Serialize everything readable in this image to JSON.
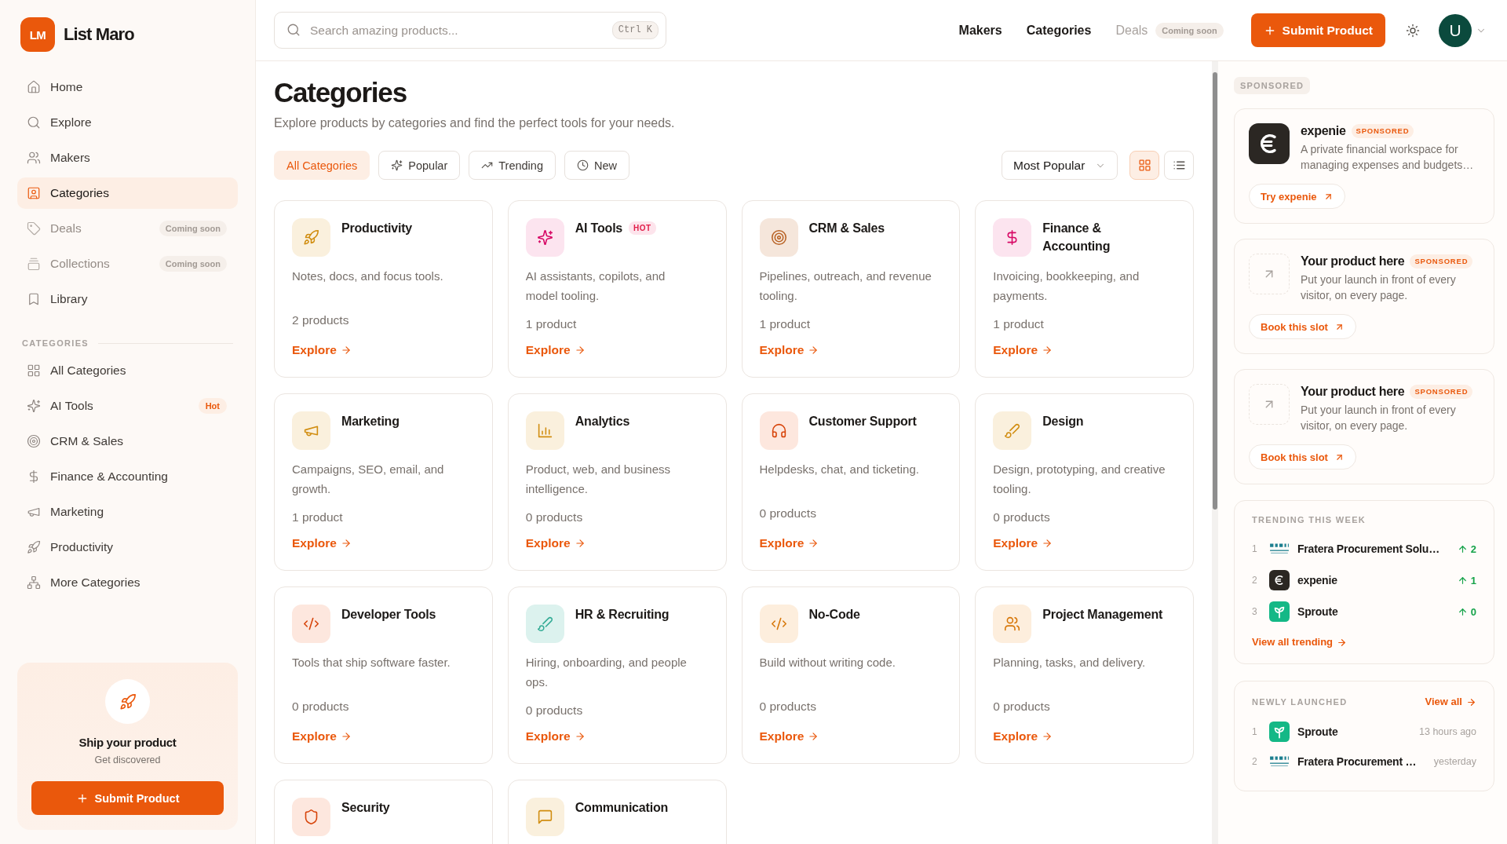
{
  "sidebar": {
    "logo": {
      "mark": "LM",
      "name": "List Maro"
    },
    "nav": [
      {
        "label": "Home",
        "selected": false,
        "disabled": false
      },
      {
        "label": "Explore",
        "selected": false,
        "disabled": false
      },
      {
        "label": "Makers",
        "selected": false,
        "disabled": false
      },
      {
        "label": "Categories",
        "selected": true,
        "disabled": false
      },
      {
        "label": "Deals",
        "selected": false,
        "disabled": true,
        "badge": "Coming soon"
      },
      {
        "label": "Collections",
        "selected": false,
        "disabled": true,
        "badge": "Coming soon"
      },
      {
        "label": "Library",
        "selected": false,
        "disabled": false
      }
    ],
    "section_title": "CATEGORIES",
    "category_links": [
      {
        "label": "All Categories",
        "selected": false
      },
      {
        "label": "AI Tools",
        "selected": false,
        "badge": "Hot"
      },
      {
        "label": "CRM & Sales",
        "selected": false
      },
      {
        "label": "Finance & Accounting",
        "selected": false
      },
      {
        "label": "Marketing",
        "selected": false
      },
      {
        "label": "Productivity",
        "selected": false
      },
      {
        "label": "More Categories",
        "selected": false
      }
    ],
    "promo": {
      "title": "Ship your product",
      "subtitle": "Get discovered",
      "button": "Submit Product"
    }
  },
  "header": {
    "search": {
      "placeholder": "Search amazing products...",
      "shortcut": "Ctrl K"
    },
    "nav": [
      {
        "label": "Makers",
        "disabled": false
      },
      {
        "label": "Categories",
        "disabled": false
      },
      {
        "label": "Deals",
        "disabled": true,
        "badge": "Coming soon"
      }
    ],
    "submit_button": "Submit Product",
    "avatar": "U"
  },
  "page": {
    "title": "Categories",
    "subtitle": "Explore products by categories and find the perfect tools for your needs.",
    "filters": [
      {
        "label": "All Categories",
        "selected": true
      },
      {
        "label": "Popular",
        "selected": false
      },
      {
        "label": "Trending",
        "selected": false
      },
      {
        "label": "New",
        "selected": false
      }
    ],
    "sort": "Most Popular",
    "view_toggle": [
      {
        "selected": true
      },
      {
        "selected": false
      }
    ],
    "categories": [
      {
        "title": "Productivity",
        "description": "Notes, docs, and focus tools.",
        "count": "2 products",
        "link": "Explore",
        "color": "#faf0dd"
      },
      {
        "title": "AI Tools",
        "badge": "HOT",
        "description": "AI assistants, copilots, and model tooling.",
        "count": "1 product",
        "link": "Explore",
        "color": "#fce4ef"
      },
      {
        "title": "CRM & Sales",
        "description": "Pipelines, outreach, and revenue tooling.",
        "count": "1 product",
        "link": "Explore",
        "color": "#f5e6db"
      },
      {
        "title": "Finance & Accounting",
        "description": "Invoicing, bookkeeping, and payments.",
        "count": "1 product",
        "link": "Explore",
        "color": "#fce4ef"
      },
      {
        "title": "Marketing",
        "description": "Campaigns, SEO, email, and growth.",
        "count": "1 product",
        "link": "Explore",
        "color": "#faf0dd"
      },
      {
        "title": "Analytics",
        "description": "Product, web, and business intelligence.",
        "count": "0 products",
        "link": "Explore",
        "color": "#faf0dd"
      },
      {
        "title": "Customer Support",
        "description": "Helpdesks, chat, and ticketing.",
        "count": "0 products",
        "link": "Explore",
        "color": "#fde7de"
      },
      {
        "title": "Design",
        "description": "Design, prototyping, and creative tooling.",
        "count": "0 products",
        "link": "Explore",
        "color": "#faf0dd"
      },
      {
        "title": "Developer Tools",
        "description": "Tools that ship software faster.",
        "count": "0 products",
        "link": "Explore",
        "color": "#fde7de"
      },
      {
        "title": "HR & Recruiting",
        "description": "Hiring, onboarding, and people ops.",
        "count": "0 products",
        "link": "Explore",
        "color": "#dcf2ee"
      },
      {
        "title": "No-Code",
        "description": "Build without writing code.",
        "count": "0 products",
        "link": "Explore",
        "color": "#fdeedd"
      },
      {
        "title": "Project Management",
        "description": "Planning, tasks, and delivery.",
        "count": "0 products",
        "link": "Explore",
        "color": "#fdeedd"
      },
      {
        "title": "Security",
        "color": "#fde7de"
      },
      {
        "title": "Communication",
        "color": "#faf0dd"
      }
    ]
  },
  "right_panel": {
    "sponsored_label": "SPONSORED",
    "ads": [
      {
        "kind": "logo",
        "name": "expenie",
        "badge": "SPONSORED",
        "description": "A private financial workspace for managing expenses and budgets…",
        "button": "Try expenie"
      },
      {
        "kind": "placeholder",
        "name": "Your product here",
        "badge": "SPONSORED",
        "description": "Put your launch in front of every visitor, on every page.",
        "button": "Book this slot"
      },
      {
        "kind": "placeholder",
        "name": "Your product here",
        "badge": "SPONSORED",
        "description": "Put your launch in front of every visitor, on every page.",
        "button": "Book this slot"
      }
    ],
    "trending": {
      "title": "TRENDING THIS WEEK",
      "items": [
        {
          "rank": "1",
          "name": "Fratera Procurement Solu…",
          "change": "2"
        },
        {
          "rank": "2",
          "name": "expenie",
          "change": "1"
        },
        {
          "rank": "3",
          "name": "Sproute",
          "change": "0"
        }
      ],
      "link": "View all trending"
    },
    "newly_launched": {
      "title": "NEWLY LAUNCHED",
      "link": "View all",
      "items": [
        {
          "rank": "1",
          "name": "Sproute",
          "time": "13 hours ago"
        },
        {
          "rank": "2",
          "name": "Fratera Procurement …",
          "time": "yesterday"
        }
      ]
    }
  }
}
